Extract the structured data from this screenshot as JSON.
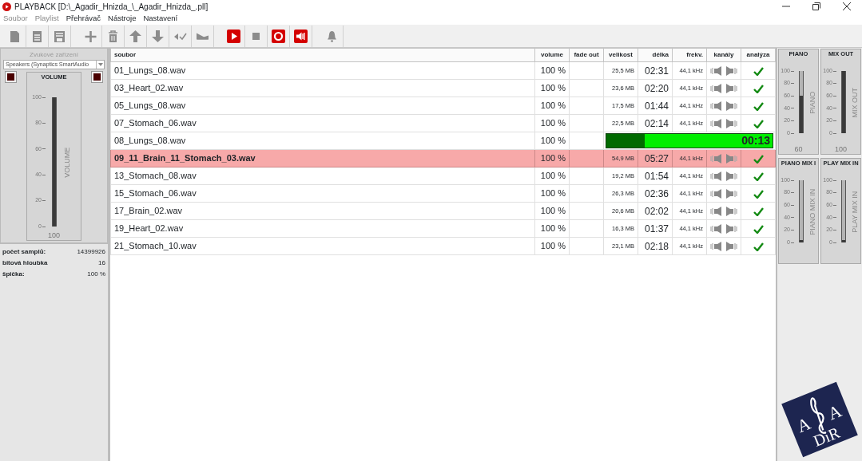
{
  "window": {
    "title": "PLAYBACK [D:\\_Agadir_Hnizda_\\_Agadir_Hnizda_.pll]"
  },
  "menu": [
    {
      "label": "Soubor",
      "disabled": true
    },
    {
      "label": "Playlist",
      "disabled": true
    },
    {
      "label": "Přehrávač",
      "disabled": false
    },
    {
      "label": "Nástroje",
      "disabled": false
    },
    {
      "label": "Nastavení",
      "disabled": false
    }
  ],
  "toolbar": [
    [
      {
        "kind": "new-file"
      },
      {
        "kind": "document"
      },
      {
        "kind": "save"
      }
    ],
    [
      {
        "kind": "plus"
      },
      {
        "kind": "trash"
      },
      {
        "kind": "arrow-up"
      },
      {
        "kind": "arrow-down"
      },
      {
        "kind": "mute-check"
      },
      {
        "kind": "ramp"
      }
    ],
    [
      {
        "kind": "play"
      },
      {
        "kind": "stop"
      },
      {
        "kind": "record"
      },
      {
        "kind": "speaker"
      }
    ],
    [
      {
        "kind": "bell"
      }
    ]
  ],
  "device": {
    "heading": "Zvukové zařízení",
    "selected": "Speakers (Synaptics SmartAudio",
    "fader": {
      "title": "VOLUME",
      "label": "VOLUME",
      "level": 1,
      "value": "100",
      "ticks": [
        "100",
        "80",
        "60",
        "40",
        "20",
        "0"
      ]
    }
  },
  "info": [
    {
      "label": "počet samplů:",
      "value": "14399926"
    },
    {
      "label": "bitová hloubka",
      "value": "16"
    },
    {
      "label": "špička:",
      "value": "100 %"
    }
  ],
  "table": {
    "columns": [
      "soubor",
      "volume",
      "fade out",
      "velikost",
      "délka",
      "frekv.",
      "kanály",
      "analýza"
    ],
    "rows": [
      {
        "kind": "track",
        "file": "01_Lungs_08.wav",
        "volume": "100 %",
        "size": "25,5 MB",
        "length": "02:31",
        "frequency": "44,1 kHz",
        "analyzed": true,
        "selected": false
      },
      {
        "kind": "track",
        "file": "03_Heart_02.wav",
        "volume": "100 %",
        "size": "23,6 MB",
        "length": "02:20",
        "frequency": "44,1 kHz",
        "analyzed": true,
        "selected": false
      },
      {
        "kind": "track",
        "file": "05_Lungs_08.wav",
        "volume": "100 %",
        "size": "17,5 MB",
        "length": "01:44",
        "frequency": "44,1 kHz",
        "analyzed": true,
        "selected": false
      },
      {
        "kind": "track",
        "file": "07_Stomach_06.wav",
        "volume": "100 %",
        "size": "22,5 MB",
        "length": "02:14",
        "frequency": "44,1 kHz",
        "analyzed": true,
        "selected": false
      },
      {
        "kind": "playing",
        "file": "08_Lungs_08.wav",
        "volume": "100 %",
        "level": 0.23,
        "elapsed": "00:13",
        "selected": false
      },
      {
        "kind": "track",
        "file": "09_11_Brain_11_Stomach_03.wav",
        "volume": "100 %",
        "size": "54,9 MB",
        "length": "05:27",
        "frequency": "44,1 kHz",
        "analyzed": true,
        "selected": true
      },
      {
        "kind": "track",
        "file": "13_Stomach_08.wav",
        "volume": "100 %",
        "size": "19,2 MB",
        "length": "01:54",
        "frequency": "44,1 kHz",
        "analyzed": true,
        "selected": false
      },
      {
        "kind": "track",
        "file": "15_Stomach_06.wav",
        "volume": "100 %",
        "size": "26,3 MB",
        "length": "02:36",
        "frequency": "44,1 kHz",
        "analyzed": true,
        "selected": false
      },
      {
        "kind": "track",
        "file": "17_Brain_02.wav",
        "volume": "100 %",
        "size": "20,6 MB",
        "length": "02:02",
        "frequency": "44,1 kHz",
        "analyzed": true,
        "selected": false
      },
      {
        "kind": "track",
        "file": "19_Heart_02.wav",
        "volume": "100 %",
        "size": "16,3 MB",
        "length": "01:37",
        "frequency": "44,1 kHz",
        "analyzed": true,
        "selected": false
      },
      {
        "kind": "track",
        "file": "21_Stomach_10.wav",
        "volume": "100 %",
        "size": "23,1 MB",
        "length": "02:18",
        "frequency": "44,1 kHz",
        "analyzed": true,
        "selected": false
      }
    ]
  },
  "mixer": [
    {
      "title": "PIANO",
      "label": "PIANO",
      "level": 0.6,
      "value": "60",
      "ticks": [
        "100",
        "80",
        "60",
        "40",
        "20",
        "0"
      ]
    },
    {
      "title": "MIX OUT",
      "label": "MIX OUT",
      "level": 1,
      "value": "100",
      "ticks": [
        "100",
        "80",
        "60",
        "40",
        "20",
        "0"
      ]
    },
    {
      "title": "PIANO MIX I",
      "label": "PIANO MIX IN",
      "level": 0,
      "ticks": [
        "100",
        "80",
        "60",
        "40",
        "20",
        "0"
      ]
    },
    {
      "title": "PLAY MIX IN",
      "label": "PLAY MIX IN",
      "level": 0,
      "ticks": [
        "100",
        "80",
        "60",
        "40",
        "20",
        "0"
      ]
    }
  ],
  "logo": {
    "left": "A",
    "right": "A",
    "bottom": "DiR"
  }
}
